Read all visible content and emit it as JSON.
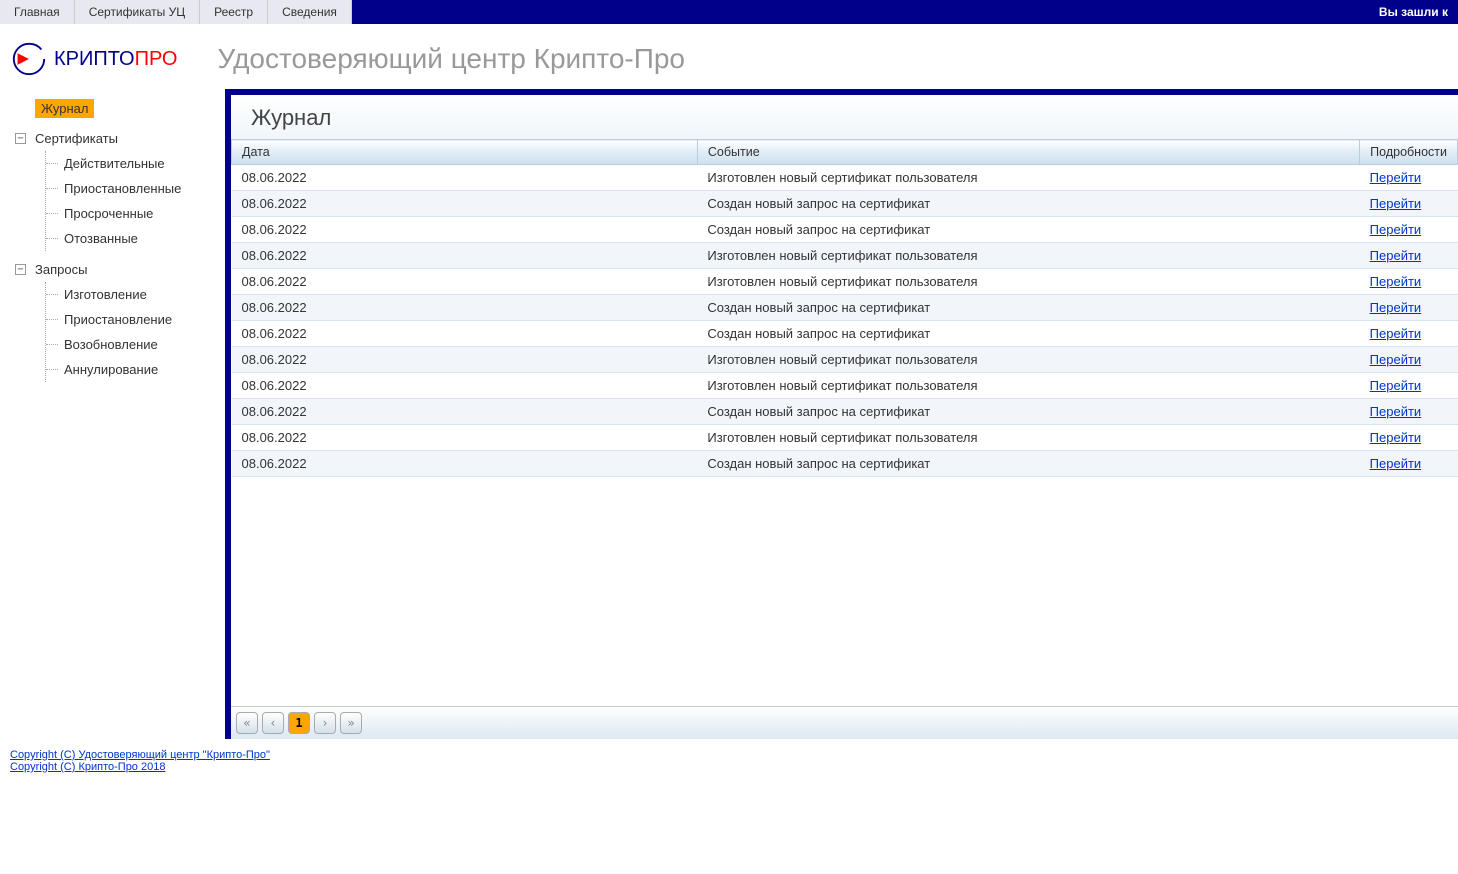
{
  "topmenu": [
    "Главная",
    "Сертификаты УЦ",
    "Реестр",
    "Сведения"
  ],
  "login_info": "Вы зашли к",
  "logo": {
    "part1": "КРИПТО",
    "part2": "ПРО"
  },
  "page_title": "Удостоверяющий центр Крипто-Про",
  "sidebar": {
    "journal": "Журнал",
    "certs_label": "Сертификаты",
    "certs_children": [
      "Действительные",
      "Приостановленные",
      "Просроченные",
      "Отозванные"
    ],
    "requests_label": "Запросы",
    "requests_children": [
      "Изготовление",
      "Приостановление",
      "Возобновление",
      "Аннулирование"
    ]
  },
  "content": {
    "title": "Журнал",
    "columns": [
      "Дата",
      "Событие",
      "Подробности"
    ],
    "link_label": "Перейти",
    "rows": [
      {
        "date": "08.06.2022",
        "event": "Изготовлен новый сертификат пользователя"
      },
      {
        "date": "08.06.2022",
        "event": "Создан новый запрос на сертификат"
      },
      {
        "date": "08.06.2022",
        "event": "Создан новый запрос на сертификат"
      },
      {
        "date": "08.06.2022",
        "event": "Изготовлен новый сертификат пользователя"
      },
      {
        "date": "08.06.2022",
        "event": "Изготовлен новый сертификат пользователя"
      },
      {
        "date": "08.06.2022",
        "event": "Создан новый запрос на сертификат"
      },
      {
        "date": "08.06.2022",
        "event": "Создан новый запрос на сертификат"
      },
      {
        "date": "08.06.2022",
        "event": "Изготовлен новый сертификат пользователя"
      },
      {
        "date": "08.06.2022",
        "event": "Изготовлен новый сертификат пользователя"
      },
      {
        "date": "08.06.2022",
        "event": "Создан новый запрос на сертификат"
      },
      {
        "date": "08.06.2022",
        "event": "Изготовлен новый сертификат пользователя"
      },
      {
        "date": "08.06.2022",
        "event": "Создан новый запрос на сертификат"
      }
    ],
    "pager": {
      "current": "1"
    }
  },
  "footer": {
    "line1": "Copyright (C) Удостоверяющий центр \"Крипто-Про\"",
    "line2": "Copyright (C) Крипто-Про 2018"
  }
}
